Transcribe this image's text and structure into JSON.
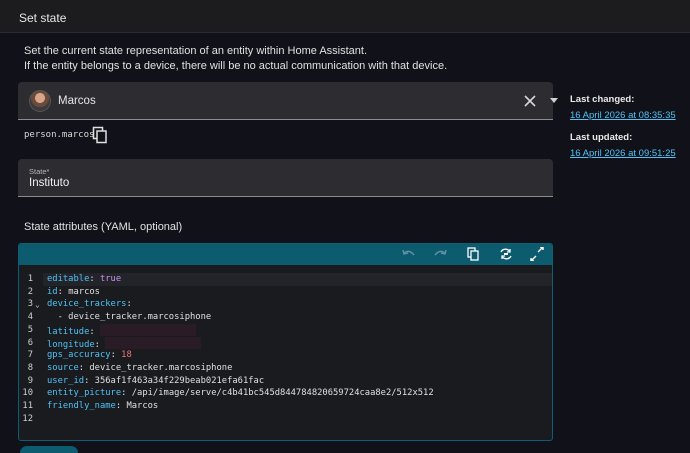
{
  "header": {
    "title": "Set state"
  },
  "description": {
    "line1": "Set the current state representation of an entity within Home Assistant.",
    "line2": "If the entity belongs to a device, there will be no actual communication with that device."
  },
  "entity": {
    "name": "Marcos",
    "id": "person.marcos"
  },
  "state": {
    "label": "State*",
    "value": "Instituto"
  },
  "attributes": {
    "title": "State attributes (YAML, optional)",
    "lines": [
      {
        "num": "1",
        "key": "editable",
        "value": "true",
        "vtype": "bool"
      },
      {
        "num": "2",
        "key": "id",
        "value": "marcos",
        "vtype": "str"
      },
      {
        "num": "3",
        "key": "device_trackers",
        "value": "",
        "vtype": "none",
        "fold": "⌄"
      },
      {
        "num": "4",
        "key": "",
        "value": "  - device_tracker.marcosiphone",
        "vtype": "str"
      },
      {
        "num": "5",
        "key": "latitude",
        "value": "",
        "vtype": "redacted"
      },
      {
        "num": "6",
        "key": "longitude",
        "value": "",
        "vtype": "redacted"
      },
      {
        "num": "7",
        "key": "gps_accuracy",
        "value": "18",
        "vtype": "num"
      },
      {
        "num": "8",
        "key": "source",
        "value": "device_tracker.marcosiphone",
        "vtype": "str"
      },
      {
        "num": "9",
        "key": "user_id",
        "value": "356af1f463a34f229beab021efa61fac",
        "vtype": "str"
      },
      {
        "num": "10",
        "key": "entity_picture",
        "value": "/api/image/serve/c4b41bc545d844784820659724caa8e2/512x512",
        "vtype": "str"
      },
      {
        "num": "11",
        "key": "friendly_name",
        "value": "Marcos",
        "vtype": "str"
      },
      {
        "num": "12",
        "key": "",
        "value": "",
        "vtype": "none"
      }
    ]
  },
  "sidebar": {
    "last_changed_label": "Last changed:",
    "last_changed_value": "16 April 2026 at 08:35:35",
    "last_updated_label": "Last updated:",
    "last_updated_value": "16 April 2026 at 09:51:25"
  },
  "icons": {
    "clear": "close-icon",
    "dropdown": "chevron-down-icon",
    "copy": "copy-icon",
    "undo": "undo-icon",
    "redo": "redo-icon",
    "editor_copy": "copy-icon",
    "refresh": "refresh-icon",
    "fullscreen": "fullscreen-icon"
  },
  "colors": {
    "accent": "#0c5b6f",
    "link": "#4fc3f7",
    "background": "#111219",
    "field": "#2c2c31"
  }
}
